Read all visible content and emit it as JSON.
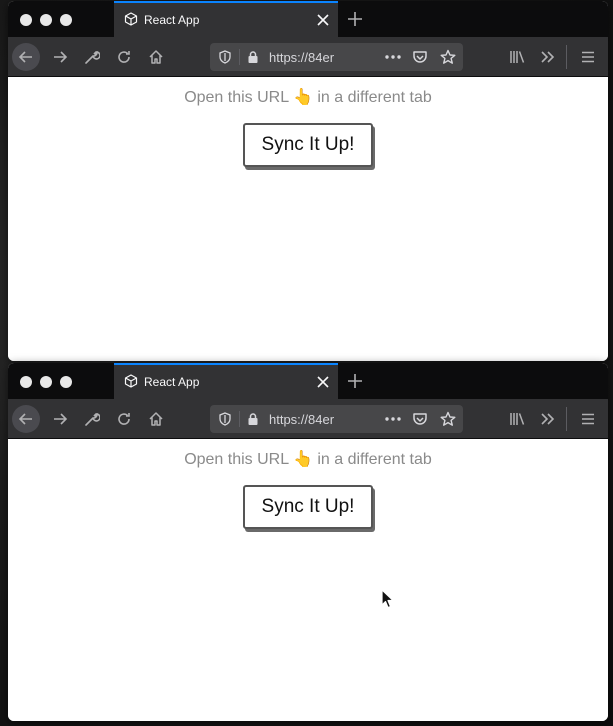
{
  "windows": [
    {
      "tab": {
        "title": "React App"
      },
      "url": "https://84er",
      "page": {
        "hint": "Open this URL 👆 in a different tab",
        "button_label": "Sync It Up!"
      }
    },
    {
      "tab": {
        "title": "React App"
      },
      "url": "https://84er",
      "page": {
        "hint": "Open this URL 👆 in a different tab",
        "button_label": "Sync It Up!"
      }
    }
  ],
  "colors": {
    "accent": "#0a84ff",
    "toolbar": "#323234",
    "tabbar": "#0c0c0d",
    "urlbar": "#474749"
  },
  "icons": [
    "cube-icon",
    "close-icon",
    "plus-icon",
    "back-arrow-icon",
    "forward-arrow-icon",
    "wrench-icon",
    "reload-icon",
    "home-icon",
    "shield-icon",
    "lock-icon",
    "more-icon",
    "pocket-icon",
    "star-icon",
    "library-icon",
    "overflow-icon",
    "hamburger-icon",
    "mouse-cursor-icon"
  ]
}
